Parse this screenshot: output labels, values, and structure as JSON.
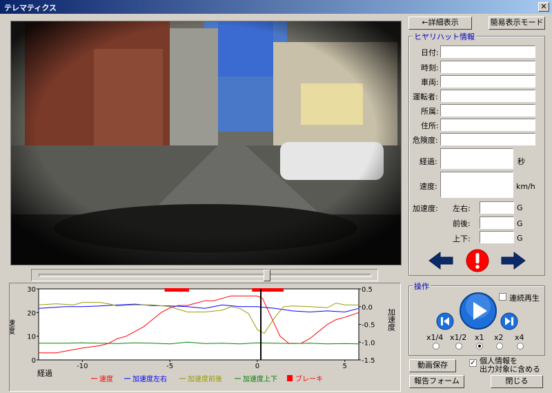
{
  "window": {
    "title": "テレマティクス",
    "close_glyph": "✕"
  },
  "toolbar": {
    "detail_button": "←詳細表示",
    "simple_mode_button": "簡易表示モード"
  },
  "info": {
    "group_label": "ヒヤリハット情報",
    "date_label": "日付:",
    "time_label": "時刻:",
    "vehicle_label": "車両:",
    "driver_label": "運転者:",
    "dept_label": "所属:",
    "address_label": "住所:",
    "danger_label": "危険度:",
    "elapsed_label": "経過:",
    "elapsed_unit": "秒",
    "speed_label": "速度:",
    "speed_unit": "km/h",
    "accel_label": "加速度:",
    "lr_label": "左右:",
    "fb_label": "前後:",
    "ud_label": "上下:",
    "g_unit": "G"
  },
  "operation": {
    "group_label": "操作",
    "continuous_label": "連続再生",
    "speeds": [
      "x1/4",
      "x1/2",
      "x1",
      "x2",
      "x4"
    ],
    "selected_speed": "x1"
  },
  "bottom": {
    "save_video": "動画保存",
    "report_form": "報告フォーム",
    "close": "閉じる",
    "personal_info_line1": "個人情報を",
    "personal_info_line2": "出力対象に含める"
  },
  "colors": {
    "speed": "#ff0000",
    "lr": "#0000ff",
    "fb": "#999900",
    "ud": "#008000",
    "brake": "#ff0000",
    "title_blue": "#0a246a",
    "nav_arrow": "#0a2a6a",
    "warning": "#ff0000",
    "play": "#1e6fd9"
  },
  "icons": [
    "close-icon",
    "left-arrow-icon",
    "warning-icon",
    "right-arrow-icon",
    "rewind-icon",
    "play-icon",
    "fast-forward-icon"
  ],
  "chart_data": {
    "type": "line",
    "xlabel": "経過",
    "ylabel": "速度",
    "y2label": "加速度",
    "xlim": [
      -12.5,
      5.8
    ],
    "ylim": [
      0,
      30
    ],
    "y2lim": [
      -1.5,
      0.5
    ],
    "xticks": [
      -10,
      -5,
      0,
      5
    ],
    "yticks": [
      0,
      10,
      20,
      30
    ],
    "y2ticks": [
      "0.5",
      "0.0",
      "-0.5",
      "-1.0",
      "-1.5"
    ],
    "legend": [
      "速度",
      "加速度左右",
      "加速度前後",
      "加速度上下",
      "ブレーキ"
    ],
    "legend_position": "bottom",
    "series": [
      {
        "name": "速度",
        "axis": "left",
        "x": [
          -12.5,
          -11.5,
          -10,
          -9,
          -8.5,
          -8,
          -7.5,
          -7,
          -6.5,
          -6,
          -5.5,
          -5,
          -4.5,
          -4,
          -3.5,
          -3,
          -2.5,
          -2,
          -1.5,
          -1,
          -0.5,
          0,
          0.3,
          0.8,
          1.3,
          1.8,
          2.5,
          3,
          3.5,
          4,
          4.5,
          5,
          5.8
        ],
        "y": [
          3,
          3,
          5,
          6,
          7,
          9,
          10,
          12,
          14,
          17,
          20,
          22,
          23,
          23,
          24,
          25,
          25,
          26,
          27,
          27,
          27,
          27,
          26,
          18,
          10,
          7,
          7,
          9,
          12,
          15,
          17,
          18,
          20
        ]
      },
      {
        "name": "加速度左右",
        "axis": "right",
        "x": [
          -12.5,
          -11,
          -10,
          -9,
          -8,
          -7,
          -6,
          -5,
          -4,
          -3,
          -2,
          -1,
          0,
          1,
          2,
          3,
          4,
          5,
          5.8
        ],
        "y": [
          -0.05,
          0,
          0,
          0.02,
          0.05,
          0.07,
          0.03,
          0.02,
          0,
          -0.05,
          0.05,
          0,
          0,
          -0.05,
          -0.12,
          -0.15,
          -0.12,
          -0.15,
          -0.05
        ]
      },
      {
        "name": "加速度前後",
        "axis": "right",
        "x": [
          -12.5,
          -11.5,
          -10.5,
          -10,
          -9,
          -8.5,
          -8,
          -7,
          -6,
          -5,
          -4,
          -3,
          -2,
          -1.5,
          -1,
          -0.5,
          0,
          0.4,
          1,
          1.5,
          2,
          3,
          4,
          4.5,
          5,
          5.8
        ],
        "y": [
          0.05,
          0.08,
          0.05,
          0.12,
          0.12,
          0.08,
          0.02,
          0.05,
          0.05,
          0,
          -0.15,
          -0.15,
          -0.1,
          0,
          -0.05,
          -0.2,
          -0.65,
          -0.75,
          -0.3,
          0,
          0.02,
          0,
          -0.03,
          0.1,
          0.05,
          0.05
        ]
      },
      {
        "name": "加速度上下",
        "axis": "right",
        "x": [
          -12.5,
          -11,
          -10,
          -9,
          -8,
          -7,
          -6,
          -5,
          -4,
          -3,
          -2,
          -1,
          0,
          1,
          2,
          3,
          4,
          5,
          5.8
        ],
        "y": [
          -1.03,
          -1.03,
          -1.02,
          -1.03,
          -1.04,
          -1.02,
          -1.03,
          -1.05,
          -1.0,
          -1.04,
          -1.03,
          -1.05,
          -1.02,
          -1.03,
          -1.04,
          -1.03,
          -1.05,
          -1.04,
          -1.05
        ]
      }
    ],
    "brake_intervals": [
      [
        -5.3,
        -3.9
      ],
      [
        -0.3,
        1.5
      ]
    ],
    "cursor_x": 0.2
  }
}
